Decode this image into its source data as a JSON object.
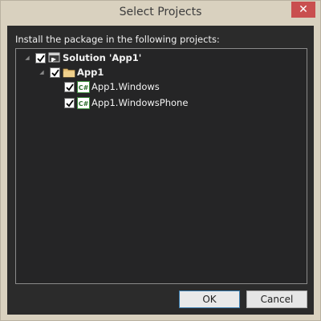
{
  "window": {
    "title": "Select Projects",
    "close_glyph": "✕"
  },
  "instruction": "Install the package in the following projects:",
  "tree": {
    "solution": {
      "label": "Solution 'App1'",
      "checked": true,
      "expanded": true,
      "icon": "solution-icon"
    },
    "folder": {
      "label": "App1",
      "checked": true,
      "expanded": true,
      "icon": "folder-icon"
    },
    "projects": [
      {
        "label": "App1.Windows",
        "checked": true,
        "icon": "csharp-project-icon",
        "icon_text": "C#"
      },
      {
        "label": "App1.WindowsPhone",
        "checked": true,
        "icon": "csharp-project-icon",
        "icon_text": "C#"
      }
    ],
    "expander_glyph": "◢"
  },
  "buttons": {
    "ok": "OK",
    "cancel": "Cancel"
  },
  "colors": {
    "close_button": "#c94f4f",
    "dialog_background": "#2b2b2b",
    "csharp_icon": "#3a8a3a"
  }
}
